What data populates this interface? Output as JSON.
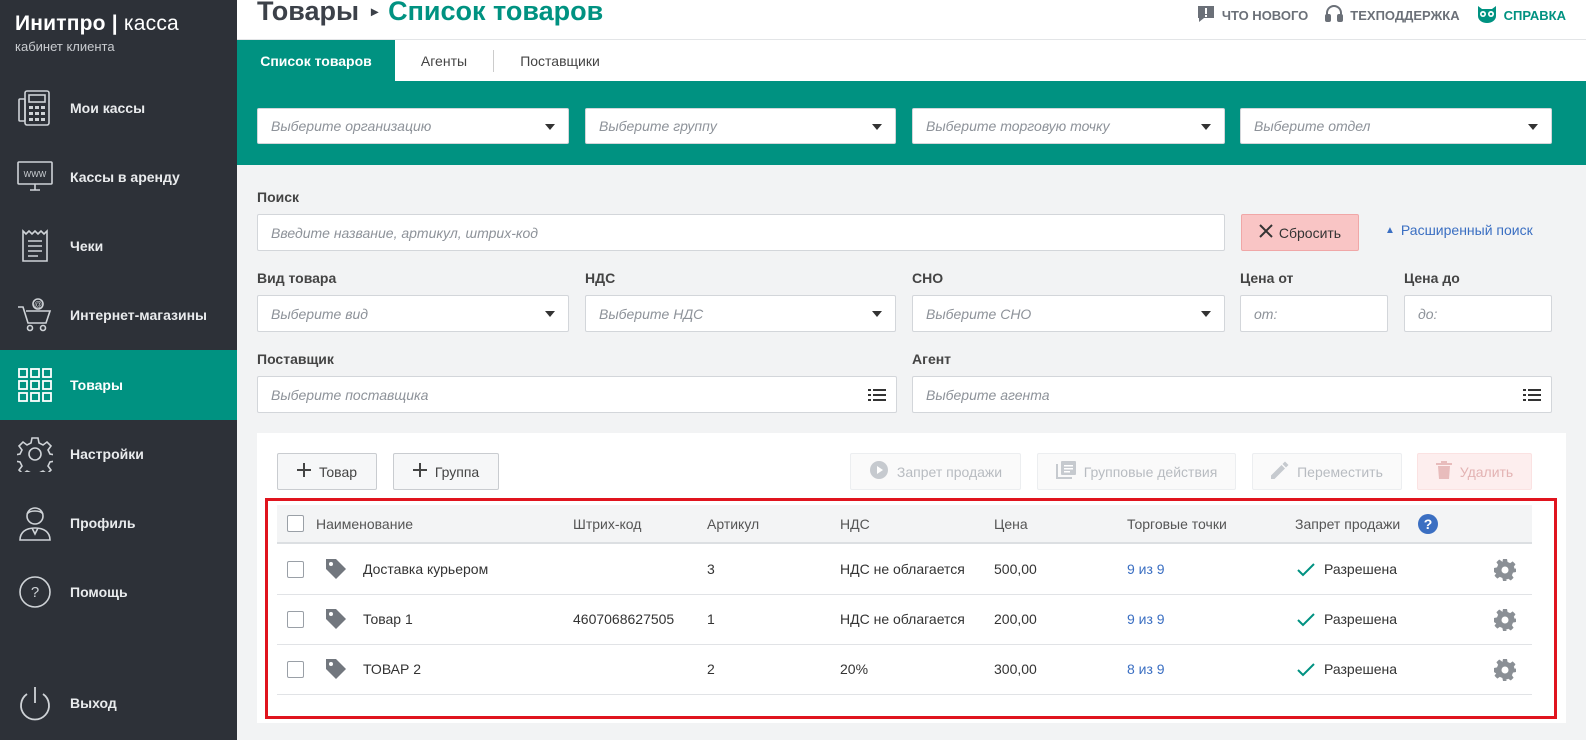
{
  "app": {
    "brand_bold": "Инитпро",
    "brand_sep": "|",
    "brand_light": "касса",
    "subtitle": "кабинет клиента"
  },
  "sidebar": {
    "items": [
      {
        "label": "Мои кассы",
        "icon": "cash-register-icon"
      },
      {
        "label": "Кассы в аренду",
        "icon": "www-monitor-icon"
      },
      {
        "label": "Чеки",
        "icon": "receipt-icon"
      },
      {
        "label": "Интернет-магазины",
        "icon": "shopping-cart-icon"
      },
      {
        "label": "Товары",
        "icon": "grid-icon",
        "active": true
      },
      {
        "label": "Настройки",
        "icon": "gear-icon"
      },
      {
        "label": "Профиль",
        "icon": "user-icon"
      },
      {
        "label": "Помощь",
        "icon": "question-circle-icon"
      }
    ],
    "logout": {
      "label": "Выход",
      "icon": "power-icon"
    }
  },
  "header": {
    "breadcrumb_root": "Товары",
    "breadcrumb_current": "Список товаров",
    "links": [
      {
        "label": "ЧТО НОВОГО",
        "icon": "news-icon"
      },
      {
        "label": "ТЕХПОДДЕРЖКА",
        "icon": "headset-icon"
      },
      {
        "label": "СПРАВКА",
        "icon": "owl-icon"
      }
    ]
  },
  "tabs": [
    {
      "label": "Список товаров",
      "active": true
    },
    {
      "label": "Агенты"
    },
    {
      "label": "Поставщики"
    }
  ],
  "filters": {
    "organization_placeholder": "Выберите организацию",
    "group_placeholder": "Выберите группу",
    "outlet_placeholder": "Выберите торговую точку",
    "department_placeholder": "Выберите отдел"
  },
  "search": {
    "label": "Поиск",
    "placeholder": "Введите название, артикул, штрих-код",
    "reset_label": "Сбросить",
    "advanced_label": "Расширенный поиск"
  },
  "advanced": {
    "type_label": "Вид товара",
    "type_placeholder": "Выберите вид",
    "vat_label": "НДС",
    "vat_placeholder": "Выберите НДС",
    "sno_label": "СНО",
    "sno_placeholder": "Выберите СНО",
    "price_from_label": "Цена от",
    "price_from_placeholder": "от:",
    "price_to_label": "Цена до",
    "price_to_placeholder": "до:",
    "supplier_label": "Поставщик",
    "supplier_placeholder": "Выберите поставщика",
    "agent_label": "Агент",
    "agent_placeholder": "Выберите агента"
  },
  "toolbar": {
    "add_product": "Товар",
    "add_group": "Группа",
    "ban_sale": "Запрет продажи",
    "group_actions": "Групповые действия",
    "move": "Переместить",
    "delete": "Удалить"
  },
  "table": {
    "columns": [
      "Наименование",
      "Штрих-код",
      "Артикул",
      "НДС",
      "Цена",
      "Торговые точки",
      "Запрет продажи"
    ],
    "rows": [
      {
        "name": "Доставка курьером",
        "barcode": "",
        "article": "3",
        "vat": "НДС не облагается",
        "price": "500,00",
        "outlets": "9 из 9",
        "sale_status": "Разрешена"
      },
      {
        "name": "Товар 1",
        "barcode": "4607068627505",
        "article": "1",
        "vat": "НДС не облагается",
        "price": "200,00",
        "outlets": "9 из 9",
        "sale_status": "Разрешена"
      },
      {
        "name": "ТОВАР 2",
        "barcode": "",
        "article": "2",
        "vat": "20%",
        "price": "300,00",
        "outlets": "8 из 9",
        "sale_status": "Разрешена"
      }
    ]
  },
  "colors": {
    "accent": "#009281",
    "sidebar": "#2d3138",
    "link": "#3b6fc2",
    "highlight_frame": "#e0141e"
  }
}
